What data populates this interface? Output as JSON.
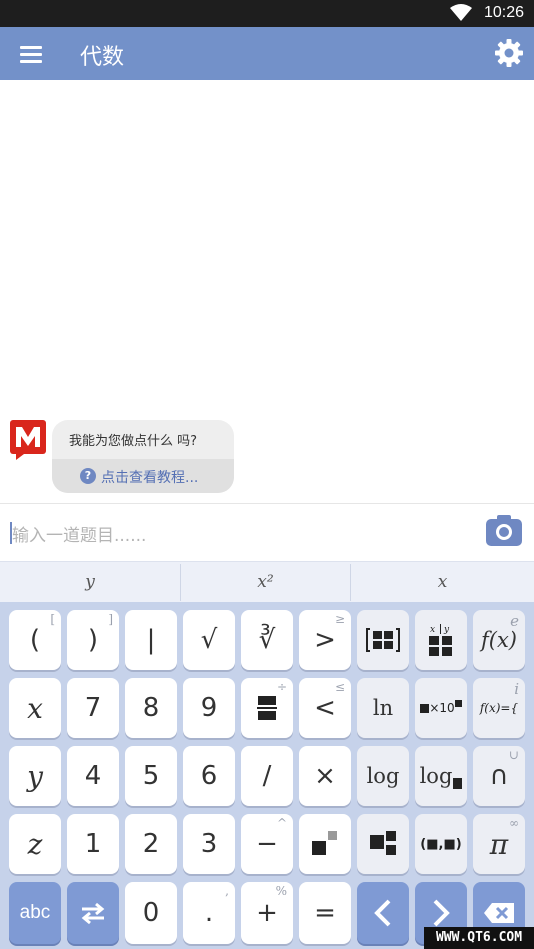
{
  "status_bar": {
    "time": "10:26"
  },
  "app_bar": {
    "title": "代数",
    "menu_icon": "hamburger-menu-icon",
    "settings_icon": "gear-icon"
  },
  "chat": {
    "avatar_icon": "mathway-logo-icon",
    "question": "我能为您做点什么 吗?",
    "tutorial_link": "点击查看教程..."
  },
  "input": {
    "placeholder": "输入一道题目......",
    "camera_icon": "camera-icon"
  },
  "suggestions": [
    "y",
    "x²",
    "x"
  ],
  "keyboard": {
    "rows": [
      [
        "(",
        ")",
        "|",
        "√",
        "∛",
        ">",
        "matrix-icon",
        "fraction-grid-icon",
        "f(x)"
      ],
      [
        "x",
        "7",
        "8",
        "9",
        "divide-fraction-icon",
        "<",
        "ln",
        "sci-notation-icon",
        "piecewise-icon"
      ],
      [
        "y",
        "4",
        "5",
        "6",
        "/",
        "×",
        "log",
        "log-base-icon",
        "∩"
      ],
      [
        "z",
        "1",
        "2",
        "3",
        "−",
        "power-icon",
        "subscript-icon",
        "interval-icon",
        "π"
      ],
      [
        "abc",
        "swap-icon",
        "0",
        ".",
        "+",
        "=",
        "left-arrow-icon",
        "right-arrow-icon",
        "backspace-icon"
      ]
    ],
    "secondary": {
      "open_paren": "[",
      "close_paren": "]",
      "greater": "≥",
      "fx": "e",
      "divide": "÷",
      "less": "≤",
      "piecewise": "i",
      "intersect": "∪",
      "minus": "^",
      "pi": "∞",
      "dot": ",",
      "plus": "%"
    },
    "labels": {
      "sci_notation": "×10",
      "piecewise": "f(x)={",
      "interval": "(■,■)",
      "log_base": "log"
    }
  },
  "colors": {
    "app_bar": "#7391c9",
    "keyboard_bg": "#c6d2ea",
    "nav_key": "#7f9ad4",
    "accent": "#5570b4"
  },
  "watermark": "WWW.QT6.COM"
}
